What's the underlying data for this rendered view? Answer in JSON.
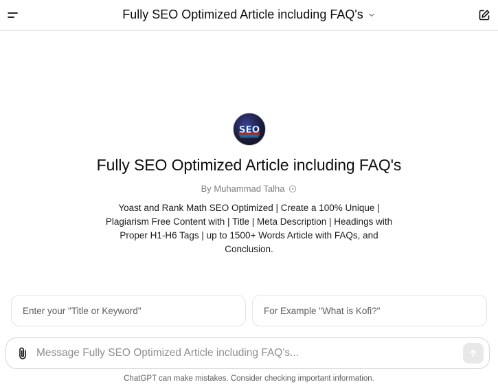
{
  "header": {
    "title": "Fully SEO Optimized Article including FAQ's"
  },
  "gpt": {
    "avatar_text": "SEO",
    "title": "Fully SEO Optimized Article including FAQ's",
    "author": "By Muhammad Talha",
    "description_lines": [
      "Yoast and Rank Math SEO Optimized | Create a 100% Unique |",
      "Plagiarism Free Content with | Title | Meta Description | Headings with",
      "Proper H1-H6 Tags | up to 1500+ Words Article with FAQs, and",
      "Conclusion."
    ]
  },
  "starters": [
    {
      "label": "Enter your \"Title or Keyword\""
    },
    {
      "label": "For Example \"What is Kofi?\""
    }
  ],
  "composer": {
    "placeholder": "Message Fully SEO Optimized Article including FAQ's..."
  },
  "footer": {
    "disclaimer": "ChatGPT can make mistakes. Consider checking important information."
  },
  "colors": {
    "text": "#0d0d0d",
    "muted": "#7d7d7d",
    "border": "#e3e3e3",
    "send_disabled": "#e8e8e8"
  }
}
